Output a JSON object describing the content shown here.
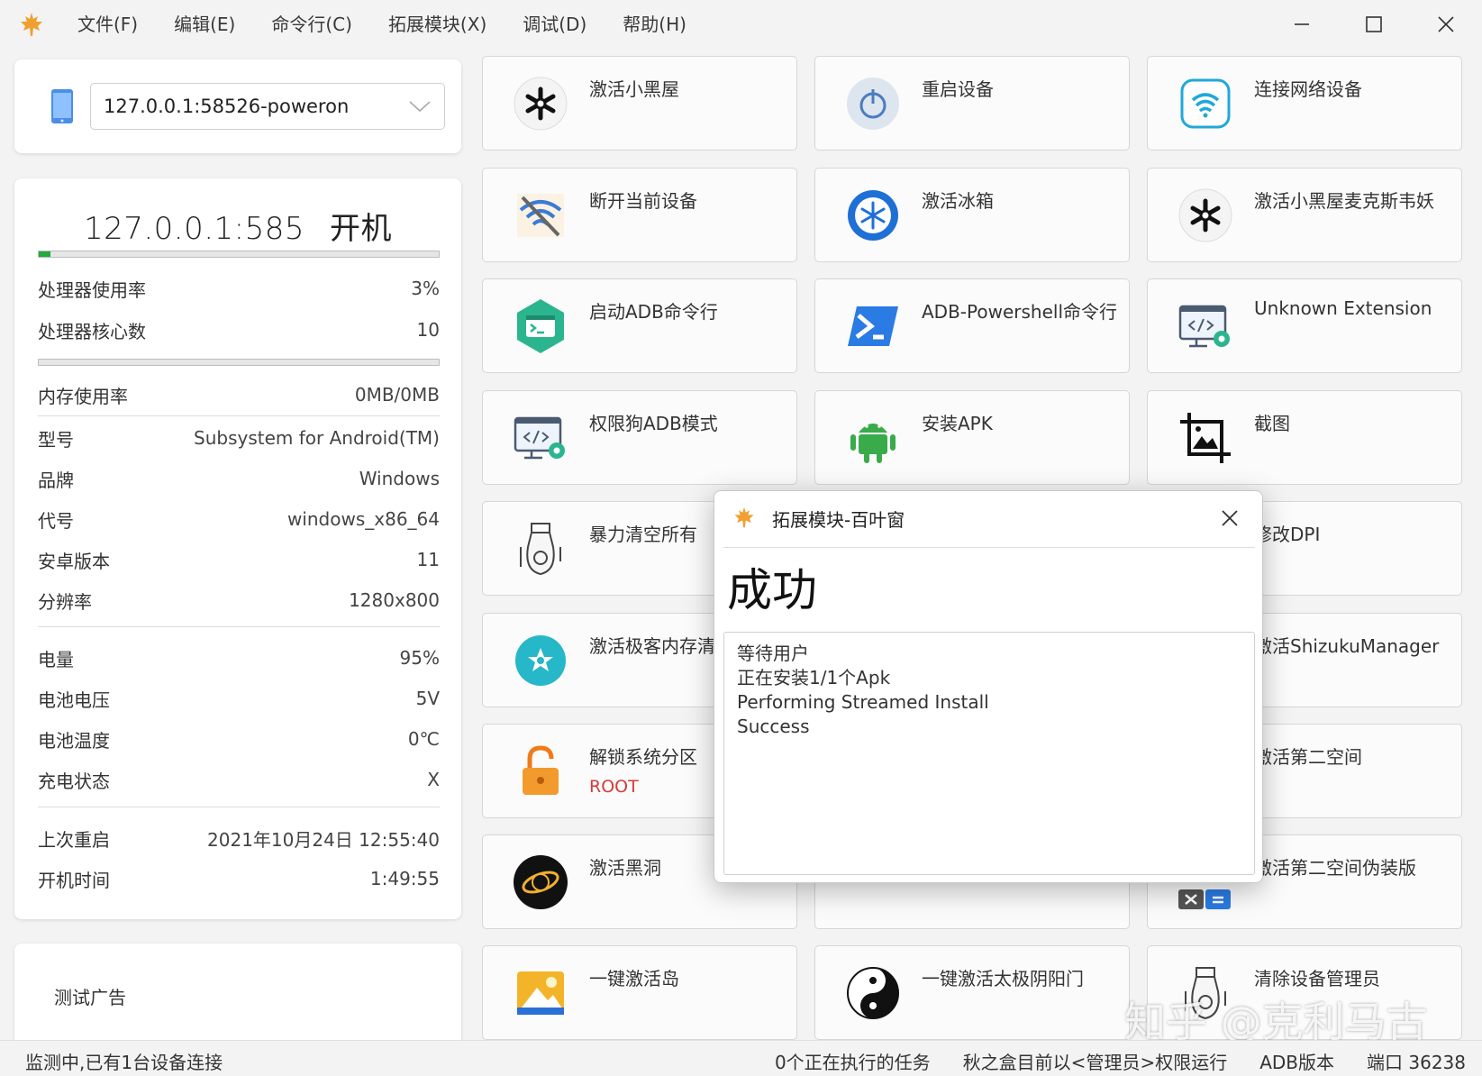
{
  "menu": [
    "文件(F)",
    "编辑(E)",
    "命令行(C)",
    "拓展模块(X)",
    "调试(D)",
    "帮助(H)"
  ],
  "device": {
    "selected": "127.0.0.1:58526-poweron"
  },
  "info": {
    "device_name": "127.0.0.1:585",
    "power_state": "开机",
    "cpu_progress": 0.03,
    "mem_progress": 0,
    "rows": {
      "cpu_usage": {
        "label": "处理器使用率",
        "value": "3%"
      },
      "cpu_cores": {
        "label": "处理器核心数",
        "value": "10"
      },
      "mem_usage": {
        "label": "内存使用率",
        "value": "0MB/0MB"
      },
      "model": {
        "label": "型号",
        "value": "Subsystem for Android(TM)"
      },
      "brand": {
        "label": "品牌",
        "value": "Windows"
      },
      "codename": {
        "label": "代号",
        "value": "windows_x86_64"
      },
      "android": {
        "label": "安卓版本",
        "value": "11"
      },
      "resolution": {
        "label": "分辨率",
        "value": "1280x800"
      },
      "battery": {
        "label": "电量",
        "value": "95%"
      },
      "voltage": {
        "label": "电池电压",
        "value": "5V"
      },
      "temperature": {
        "label": "电池温度",
        "value": "0℃"
      },
      "charging": {
        "label": "充电状态",
        "value": "X"
      },
      "last_reboot": {
        "label": "上次重启",
        "value": "2021年10月24日 12:55:40"
      },
      "uptime": {
        "label": "开机时间",
        "value": "1:49:55"
      }
    }
  },
  "ad": {
    "text": "测试广告"
  },
  "tiles": [
    {
      "label": "激活小黑屋",
      "icon": "snowflake-gear-icon"
    },
    {
      "label": "重启设备",
      "icon": "power-icon"
    },
    {
      "label": "连接网络设备",
      "icon": "wifi-icon"
    },
    {
      "label": "断开当前设备",
      "icon": "wifi-off-icon"
    },
    {
      "label": "激活冰箱",
      "icon": "fridge-snowflake-icon"
    },
    {
      "label": "激活小黑屋麦克斯韦妖",
      "icon": "snowflake-gear-icon"
    },
    {
      "label": "启动ADB命令行",
      "icon": "terminal-icon"
    },
    {
      "label": "ADB-Powershell命令行",
      "icon": "powershell-icon"
    },
    {
      "label": "Unknown Extension",
      "icon": "code-gear-icon"
    },
    {
      "label": "权限狗ADB模式",
      "icon": "code-gear-icon"
    },
    {
      "label": "安装APK",
      "icon": "android-icon"
    },
    {
      "label": "截图",
      "icon": "screenshot-icon"
    },
    {
      "label": "暴力清空所有",
      "icon": "bomb-icon"
    },
    {
      "label": "",
      "icon": ""
    },
    {
      "label": "修改DPI",
      "icon": ""
    },
    {
      "label": "激活极客内存清",
      "icon": "star-gear-icon"
    },
    {
      "label": "",
      "icon": ""
    },
    {
      "label": "激活ShizukuManager",
      "icon": ""
    },
    {
      "label": "解锁系统分区",
      "sub": "ROOT",
      "icon": "unlock-icon"
    },
    {
      "label": "",
      "icon": ""
    },
    {
      "label": "激活第二空间",
      "icon": ""
    },
    {
      "label": "激活黑洞",
      "icon": "blackhole-icon"
    },
    {
      "label": "",
      "icon": ""
    },
    {
      "label": "激活第二空间伪装版",
      "icon": "calculator-icon"
    },
    {
      "label": "一键激活岛",
      "icon": "island-icon"
    },
    {
      "label": "一键激活太极阴阳门",
      "icon": "yinyang-icon"
    },
    {
      "label": "清除设备管理员",
      "icon": "bomb-icon"
    }
  ],
  "dialog": {
    "title": "拓展模块-百叶窗",
    "heading": "成功",
    "log": [
      "等待用户",
      "正在安装1/1个Apk",
      "Performing Streamed Install",
      "Success"
    ]
  },
  "status": {
    "left": "监测中,已有1台设备连接",
    "tasks": "0个正在执行的任务",
    "privilege": "秋之盒目前以<管理员>权限运行",
    "adb": "ADB版本",
    "port": "端口 36238"
  },
  "watermark": "知乎 @克利马古",
  "colors": {
    "accent_green": "#22aa3c",
    "root_red": "#d83a3a",
    "maple_orange": "#f0a030"
  }
}
